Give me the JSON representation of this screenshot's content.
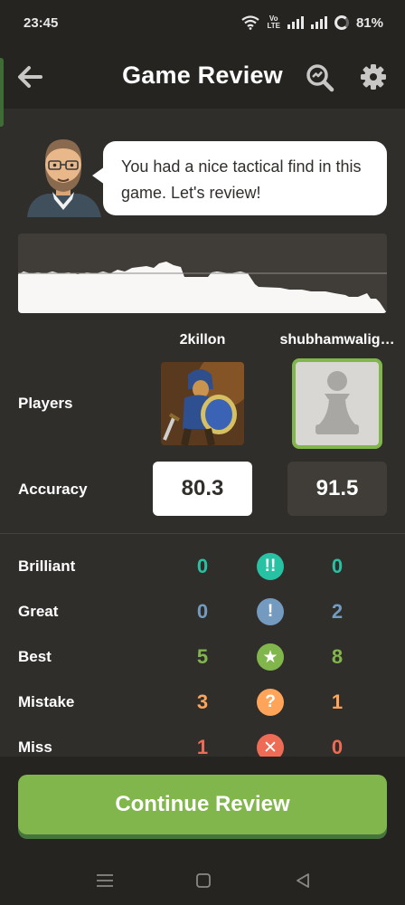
{
  "status_bar": {
    "time": "23:45",
    "volte_top": "Vo",
    "volte_bottom": "LTE",
    "battery": "81%"
  },
  "header": {
    "title": "Game Review",
    "icons": [
      "back-arrow-icon",
      "magnifier-analysis-icon",
      "gear-icon"
    ]
  },
  "coach": {
    "message": "You had a nice tactical find in this game. Let's review!"
  },
  "players": {
    "row_label": "Players",
    "white": {
      "name": "2killon"
    },
    "black": {
      "name": "shubhamwalig…"
    }
  },
  "accuracy": {
    "label": "Accuracy",
    "white": "80.3",
    "black": "91.5"
  },
  "classifications": [
    {
      "label": "Brilliant",
      "white": "0",
      "black": "0",
      "icon": "!!",
      "color": "#26c2a3"
    },
    {
      "label": "Great",
      "white": "0",
      "black": "2",
      "icon": "!",
      "color": "#749bbf"
    },
    {
      "label": "Best",
      "white": "5",
      "black": "8",
      "icon": "★",
      "color": "#81b64c"
    },
    {
      "label": "Mistake",
      "white": "3",
      "black": "1",
      "icon": "?",
      "color": "#ffa459"
    },
    {
      "label": "Miss",
      "white": "1",
      "black": "0",
      "icon": "✕",
      "color": "#ee6b55"
    }
  ],
  "continue_button": {
    "label": "Continue Review"
  },
  "colors": {
    "background": "#302e2b",
    "bar": "#262421",
    "accent_green": "#81b64c",
    "brilliant": "#26c2a3",
    "great": "#749bbf",
    "mistake": "#ffa459",
    "miss": "#ee6b55"
  }
}
